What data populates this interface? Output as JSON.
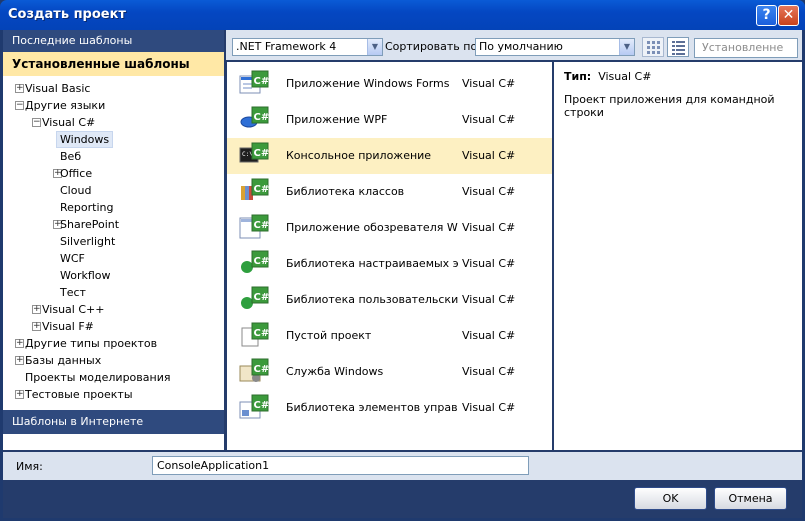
{
  "window": {
    "title": "Создать проект"
  },
  "title_buttons": {
    "help": "?",
    "close": "✕"
  },
  "left": {
    "recent": "Последние шаблоны",
    "installed": "Установленные шаблоны",
    "online": "Шаблоны в Интернете",
    "tree": [
      {
        "label": "Visual Basic",
        "expander": "+"
      },
      {
        "label": "Другие языки",
        "expander": "−"
      },
      {
        "label": "Visual C#",
        "expander": "−"
      },
      {
        "label": "Windows",
        "expander": ""
      },
      {
        "label": "Веб",
        "expander": ""
      },
      {
        "label": "Office",
        "expander": "+"
      },
      {
        "label": "Cloud",
        "expander": ""
      },
      {
        "label": "Reporting",
        "expander": ""
      },
      {
        "label": "SharePoint",
        "expander": "+"
      },
      {
        "label": "Silverlight",
        "expander": ""
      },
      {
        "label": "WCF",
        "expander": ""
      },
      {
        "label": "Workflow",
        "expander": ""
      },
      {
        "label": "Тест",
        "expander": ""
      },
      {
        "label": "Visual C++",
        "expander": "+"
      },
      {
        "label": "Visual F#",
        "expander": "+"
      },
      {
        "label": "Другие типы проектов",
        "expander": "+"
      },
      {
        "label": "Базы данных",
        "expander": "+"
      },
      {
        "label": "Проекты моделирования",
        "expander": ""
      },
      {
        "label": "Тестовые проекты",
        "expander": "+"
      }
    ]
  },
  "toolbar": {
    "framework": ".NET Framework 4",
    "sort_label": "Сортировать по:",
    "sort_value": "По умолчанию",
    "search_placeholder": "Установленне"
  },
  "templates": [
    {
      "name": "Приложение Windows Forms",
      "lang": "Visual C#",
      "icon": "winforms-icon"
    },
    {
      "name": "Приложение WPF",
      "lang": "Visual C#",
      "icon": "wpf-icon"
    },
    {
      "name": "Консольное приложение",
      "lang": "Visual C#",
      "icon": "console-icon"
    },
    {
      "name": "Библиотека классов",
      "lang": "Visual C#",
      "icon": "class-library-icon"
    },
    {
      "name": "Приложение обозревателя WPF",
      "lang": "Visual C#",
      "icon": "wpf-browser-icon"
    },
    {
      "name": "Библиотека настраиваемых эле...",
      "lang": "Visual C#",
      "icon": "custom-control-icon"
    },
    {
      "name": "Библиотека пользовательских э...",
      "lang": "Visual C#",
      "icon": "user-control-icon"
    },
    {
      "name": "Пустой проект",
      "lang": "Visual C#",
      "icon": "empty-project-icon"
    },
    {
      "name": "Служба Windows",
      "lang": "Visual C#",
      "icon": "windows-service-icon"
    },
    {
      "name": "Библиотека элементов управлен...",
      "lang": "Visual C#",
      "icon": "control-library-icon"
    }
  ],
  "selected_template_index": 2,
  "description": {
    "type_label": "Тип:",
    "type_value": "Visual C#",
    "text": "Проект приложения для командной строки"
  },
  "name_field": {
    "label": "Имя:",
    "value": "ConsoleApplication1"
  },
  "buttons": {
    "ok": "OK",
    "cancel": "Отмена"
  },
  "colors": {
    "title_bar": "#0a5bd6",
    "selection": "#fdf0c2",
    "installed_header": "#ffe8a6",
    "panel_dark": "#253c6b"
  }
}
